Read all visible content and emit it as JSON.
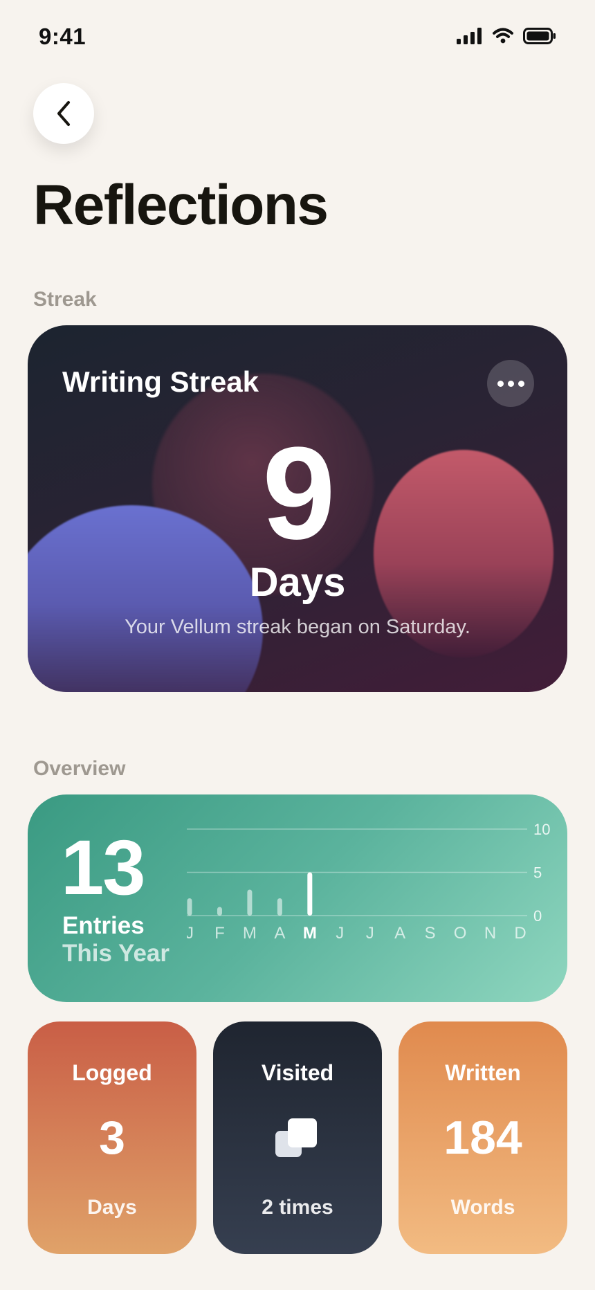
{
  "status_bar": {
    "time": "9:41"
  },
  "header": {
    "title": "Reflections"
  },
  "streak_section": {
    "label": "Streak",
    "card": {
      "title": "Writing Streak",
      "value": "9",
      "unit": "Days",
      "subtitle": "Your Vellum streak began on Saturday."
    }
  },
  "overview_section": {
    "label": "Overview",
    "card": {
      "value": "13",
      "label_line1": "Entries",
      "label_line2": "This Year"
    }
  },
  "stats": {
    "logged": {
      "title": "Logged",
      "value": "3",
      "foot": "Days"
    },
    "visited": {
      "title": "Visited",
      "icon": "copy-icon",
      "foot": "2 times"
    },
    "written": {
      "title": "Written",
      "value": "184",
      "foot": "Words"
    }
  },
  "chart_data": {
    "type": "bar",
    "categories": [
      "J",
      "F",
      "M",
      "A",
      "M",
      "J",
      "J",
      "A",
      "S",
      "O",
      "N",
      "D"
    ],
    "values": [
      2,
      1,
      3,
      2,
      5,
      0,
      0,
      0,
      0,
      0,
      0,
      0
    ],
    "highlight_index": 4,
    "ylim": [
      0,
      10
    ],
    "yticks": [
      10,
      5,
      0
    ],
    "grid": true
  },
  "colors": {
    "background": "#f7f3ee",
    "streak_card": "#2a2334",
    "overview_card": "#5bb39d",
    "logged_card": "#d97c55",
    "visited_card": "#2a313d",
    "written_card": "#ea9f66"
  }
}
